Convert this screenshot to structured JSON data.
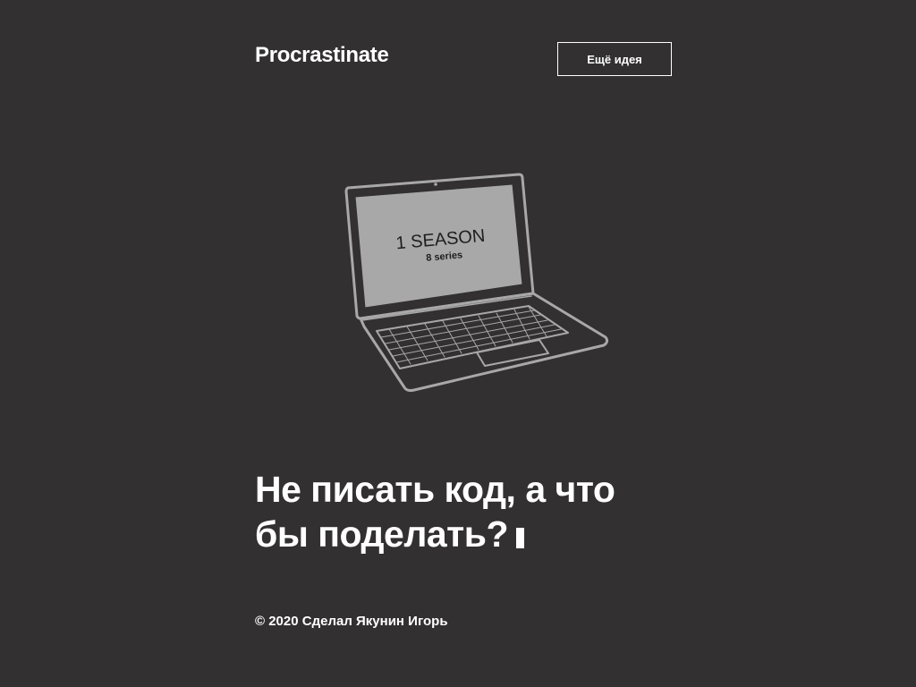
{
  "header": {
    "logo": "Procrastinate",
    "more_button_label": "Ещё идея"
  },
  "illustration": {
    "screen_title": "1 SEASON",
    "screen_subtitle": "8 series"
  },
  "headline": {
    "line1": "Не писать код, а что",
    "line2": "бы поделать?"
  },
  "footer": {
    "copyright": "© 2020 Сделал Якунин Игорь"
  },
  "colors": {
    "background": "#323031",
    "foreground": "#ffffff",
    "laptop_screen": "#a8a8a8"
  }
}
